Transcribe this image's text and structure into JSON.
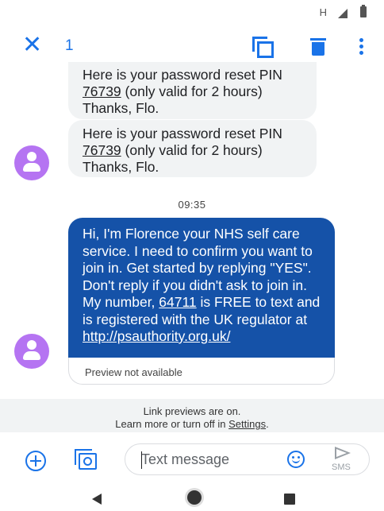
{
  "status_bar": {
    "network": "H"
  },
  "action_bar": {
    "selected_count": "1",
    "icons": [
      "close-icon",
      "copy-icon",
      "delete-icon",
      "more-vert-icon"
    ]
  },
  "messages": [
    {
      "direction": "incoming",
      "text_before": "Here is your password reset PIN ",
      "pin": "76739",
      "text_after": " (only valid for 2 hours) Thanks, Flo."
    },
    {
      "direction": "incoming",
      "text_before": "Here is your password reset PIN ",
      "pin": "76739",
      "text_after": " (only valid for 2 hours) Thanks, Flo."
    }
  ],
  "timestamp": "09:35",
  "outgoing_message": {
    "text_before": "Hi, I'm Florence your NHS self care service. I need to confirm you want to join in. Get started by replying \"YES\". Don't reply if you didn't ask to join in. My number, ",
    "number": "64711",
    "text_middle": " is FREE to text and is registered with the UK regulator at ",
    "link": "http://psauthority.org.uk/",
    "preview_text": "Preview not available"
  },
  "link_notice": {
    "line1": "Link previews are on.",
    "line2_before": "Learn more or turn off in ",
    "settings_link": "Settings",
    "line2_after": "."
  },
  "compose": {
    "placeholder": "Text message",
    "send_label": "SMS"
  },
  "colors": {
    "accent": "#1a73e8",
    "outgoing_bubble": "#1552a8",
    "incoming_bubble": "#f1f3f4",
    "avatar": "#b574f2"
  }
}
